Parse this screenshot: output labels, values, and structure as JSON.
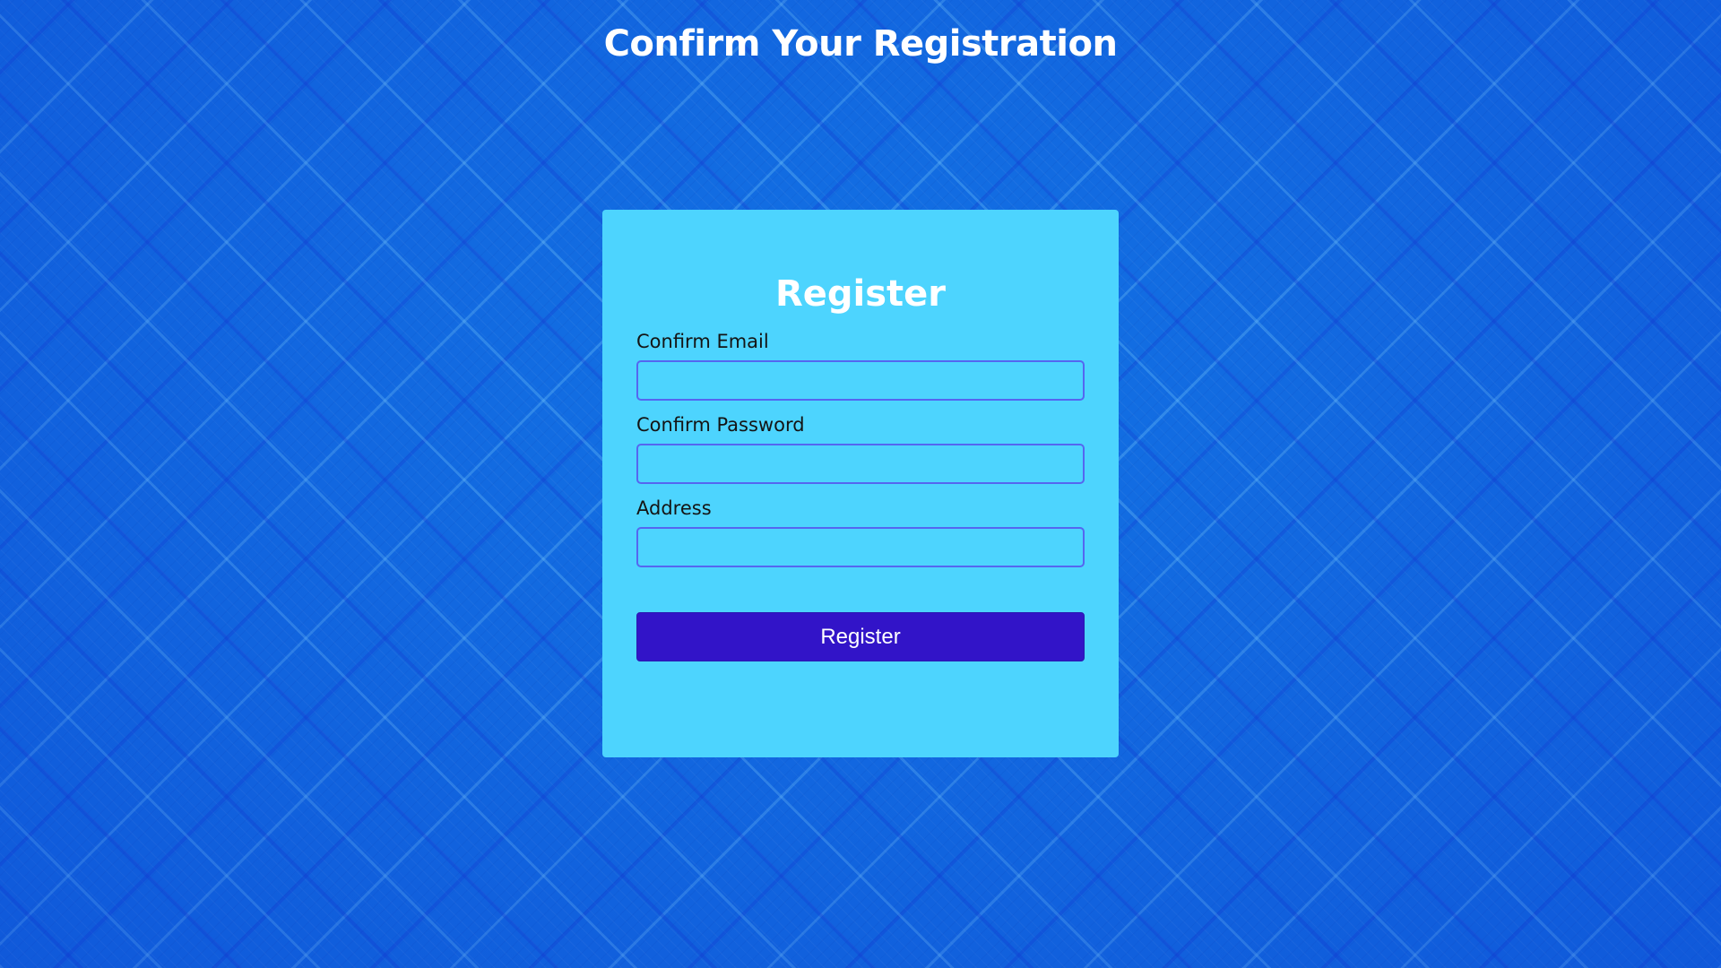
{
  "page": {
    "title": "Confirm Your Registration"
  },
  "form": {
    "title": "Register",
    "fields": [
      {
        "label": "Confirm Email",
        "value": "",
        "placeholder": ""
      },
      {
        "label": "Confirm Password",
        "value": "",
        "placeholder": ""
      },
      {
        "label": "Address",
        "value": "",
        "placeholder": ""
      }
    ],
    "submit_label": "Register"
  },
  "colors": {
    "background": "#1373e4",
    "card": "#4dd4fe",
    "input_border": "#5566f0",
    "button": "#3214c8",
    "heading_text": "#ffffff",
    "label_text": "#141414"
  }
}
